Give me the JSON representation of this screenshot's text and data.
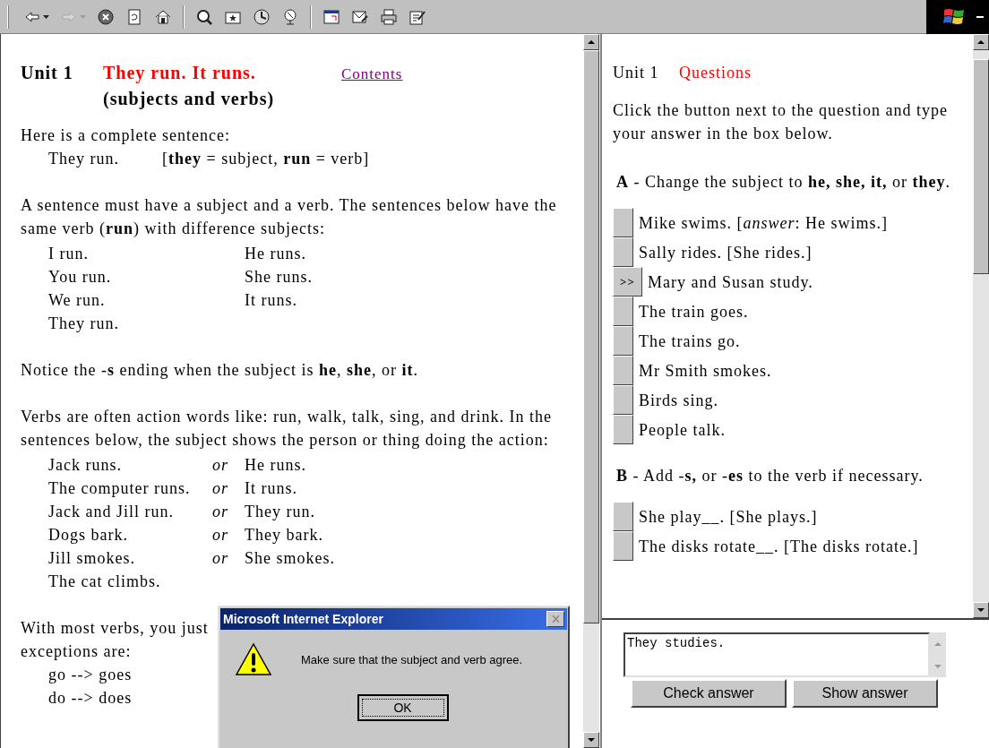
{
  "toolbar": {
    "buttons": [
      {
        "kind": "back",
        "dropdown": true,
        "disabled": false
      },
      {
        "kind": "forward",
        "dropdown": true,
        "disabled": true
      },
      {
        "kind": "stop",
        "dropdown": false,
        "disabled": false
      },
      {
        "kind": "refresh",
        "dropdown": false,
        "disabled": false
      },
      {
        "kind": "home",
        "dropdown": false,
        "disabled": false
      },
      {
        "kind": "sep"
      },
      {
        "kind": "search",
        "dropdown": false,
        "disabled": false
      },
      {
        "kind": "favorites",
        "dropdown": false,
        "disabled": false
      },
      {
        "kind": "history",
        "dropdown": false,
        "disabled": false
      },
      {
        "kind": "channels",
        "dropdown": false,
        "disabled": false
      },
      {
        "kind": "sep"
      },
      {
        "kind": "fullscreen",
        "dropdown": false,
        "disabled": false
      },
      {
        "kind": "mail",
        "dropdown": false,
        "disabled": false
      },
      {
        "kind": "print",
        "dropdown": false,
        "disabled": false
      },
      {
        "kind": "edit",
        "dropdown": false,
        "disabled": false
      }
    ]
  },
  "lesson": {
    "unit": "Unit 1",
    "title": "They run. It runs.",
    "subtitle": "(subjects and verbs)",
    "contents_link": "Contents",
    "intro": "Here is a complete sentence:",
    "example": {
      "sentence": "They run.",
      "analysis": "[**they** = subject,  **run** = verb]"
    },
    "paragraph_1": "A sentence must have a subject and a verb. The sentences below have the same verb (**run**) with difference subjects:",
    "pairs_1": [
      {
        "left": "I run.",
        "right": "He runs."
      },
      {
        "left": "You run.",
        "right": "She runs."
      },
      {
        "left": "We run.",
        "right": "It runs."
      },
      {
        "left": "They run."
      }
    ],
    "notice": "Notice the -**s** ending when the subject is **he**, **she**, or **it**.",
    "paragraph_2": "Verbs are often action words like: run, walk, talk, sing, and drink. In the sentences below, the subject shows the person or thing doing the action:",
    "pairs_2": [
      {
        "left": "Jack runs.",
        "or": "or",
        "right": "He runs."
      },
      {
        "left": "The computer runs.",
        "or": "or",
        "right": "It  runs."
      },
      {
        "left": "Jack and Jill run.",
        "or": "or",
        "right": "They run."
      },
      {
        "left": "Dogs bark.",
        "or": "or",
        "right": "They bark."
      },
      {
        "left": "Jill smokes.",
        "or": "or",
        "right": "She smokes."
      },
      {
        "left": "The cat climbs."
      }
    ],
    "paragraph_3_lines": [
      "With most verbs, you just",
      "exceptions are:"
    ],
    "exceptions": [
      "go --> goes",
      "do --> does"
    ]
  },
  "questions": {
    "unit": "Unit 1",
    "title": "Questions",
    "instructions": "Click the button next to the question and type your answer in the box below.",
    "current_marker": ">>",
    "sections": [
      {
        "heading": "**A** - Change the subject to **he, she, it,** or **they**.",
        "items": [
          {
            "text": "Mike swims. [*answer*: He swims.]",
            "selected": false
          },
          {
            "text": "Sally rides. [She rides.]",
            "selected": false
          },
          {
            "text": "Mary and Susan study.",
            "selected": true
          },
          {
            "text": "The train goes.",
            "selected": false
          },
          {
            "text": "The trains go.",
            "selected": false
          },
          {
            "text": "Mr Smith smokes.",
            "selected": false
          },
          {
            "text": "Birds sing.",
            "selected": false
          },
          {
            "text": "People talk.",
            "selected": false
          }
        ]
      },
      {
        "heading": "**B** - Add -**s,** or -**es** to the verb if necessary.",
        "items": [
          {
            "text": "She play__. [She plays.]",
            "selected": false
          },
          {
            "text": "The disks rotate__.   [The disks rotate.]",
            "selected": false
          }
        ]
      }
    ]
  },
  "answer": {
    "value": "They studies.",
    "check_button": "Check answer",
    "show_button": "Show answer"
  },
  "dialog": {
    "title": "Microsoft Internet Explorer",
    "message": "Make sure that the subject and verb agree.",
    "ok_button": "OK"
  }
}
